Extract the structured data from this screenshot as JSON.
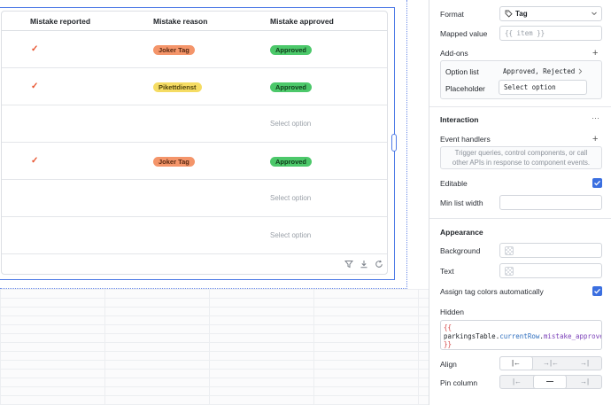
{
  "table": {
    "columns": [
      "Mistake reported",
      "Mistake reason",
      "Mistake approved"
    ],
    "rows": [
      {
        "reported": "✓",
        "reason": "Joker Tag",
        "approved": "Approved"
      },
      {
        "reported": "✓",
        "reason": "Pikettdienst",
        "approved": "Approved"
      },
      {
        "reported": "",
        "reason": "",
        "approved": "Select option"
      },
      {
        "reported": "✓",
        "reason": "Joker Tag",
        "approved": "Approved"
      },
      {
        "reported": "",
        "reason": "",
        "approved": "Select option"
      },
      {
        "reported": "",
        "reason": "",
        "approved": "Select option"
      }
    ],
    "tag_colors": {
      "Joker Tag": "#f4956a",
      "Pikettdienst": "#f5dc63",
      "Approved": "#4cc86a"
    },
    "footer_icons": [
      "filter-icon",
      "download-icon",
      "refresh-icon"
    ]
  },
  "inspector": {
    "format_label": "Format",
    "format_value": "Tag",
    "mapped_value_label": "Mapped value",
    "mapped_value": "{{ item }}",
    "addons_label": "Add-ons",
    "option_list_label": "Option list",
    "option_list_value": "Approved, Rejected",
    "placeholder_label": "Placeholder",
    "placeholder_value": "Select option",
    "interaction_title": "Interaction",
    "interaction_menu": "···",
    "event_handlers_label": "Event handlers",
    "event_handlers_hint": "Trigger queries, control components, or call other APIs in response to component events.",
    "editable_label": "Editable",
    "editable": true,
    "min_list_width_label": "Min list width",
    "appearance_title": "Appearance",
    "background_label": "Background",
    "text_label": "Text",
    "assign_colors_label": "Assign tag colors automatically",
    "assign_colors": true,
    "hidden_label": "Hidden",
    "hidden_open": "{{",
    "hidden_expr_obj": "parkingsTable",
    "hidden_expr_dot1": ".",
    "hidden_expr_prop1": "currentRow",
    "hidden_expr_dot2": ".",
    "hidden_expr_prop2": "mistake_approved",
    "hidden_close": "}}",
    "align_label": "Align",
    "align_options": [
      "|←",
      "→|←",
      "→|"
    ],
    "align_selected": 0,
    "pin_label": "Pin column",
    "pin_options": [
      "|←",
      "—",
      "→|"
    ],
    "pin_selected": 1,
    "accent": "#3b6fe0"
  }
}
